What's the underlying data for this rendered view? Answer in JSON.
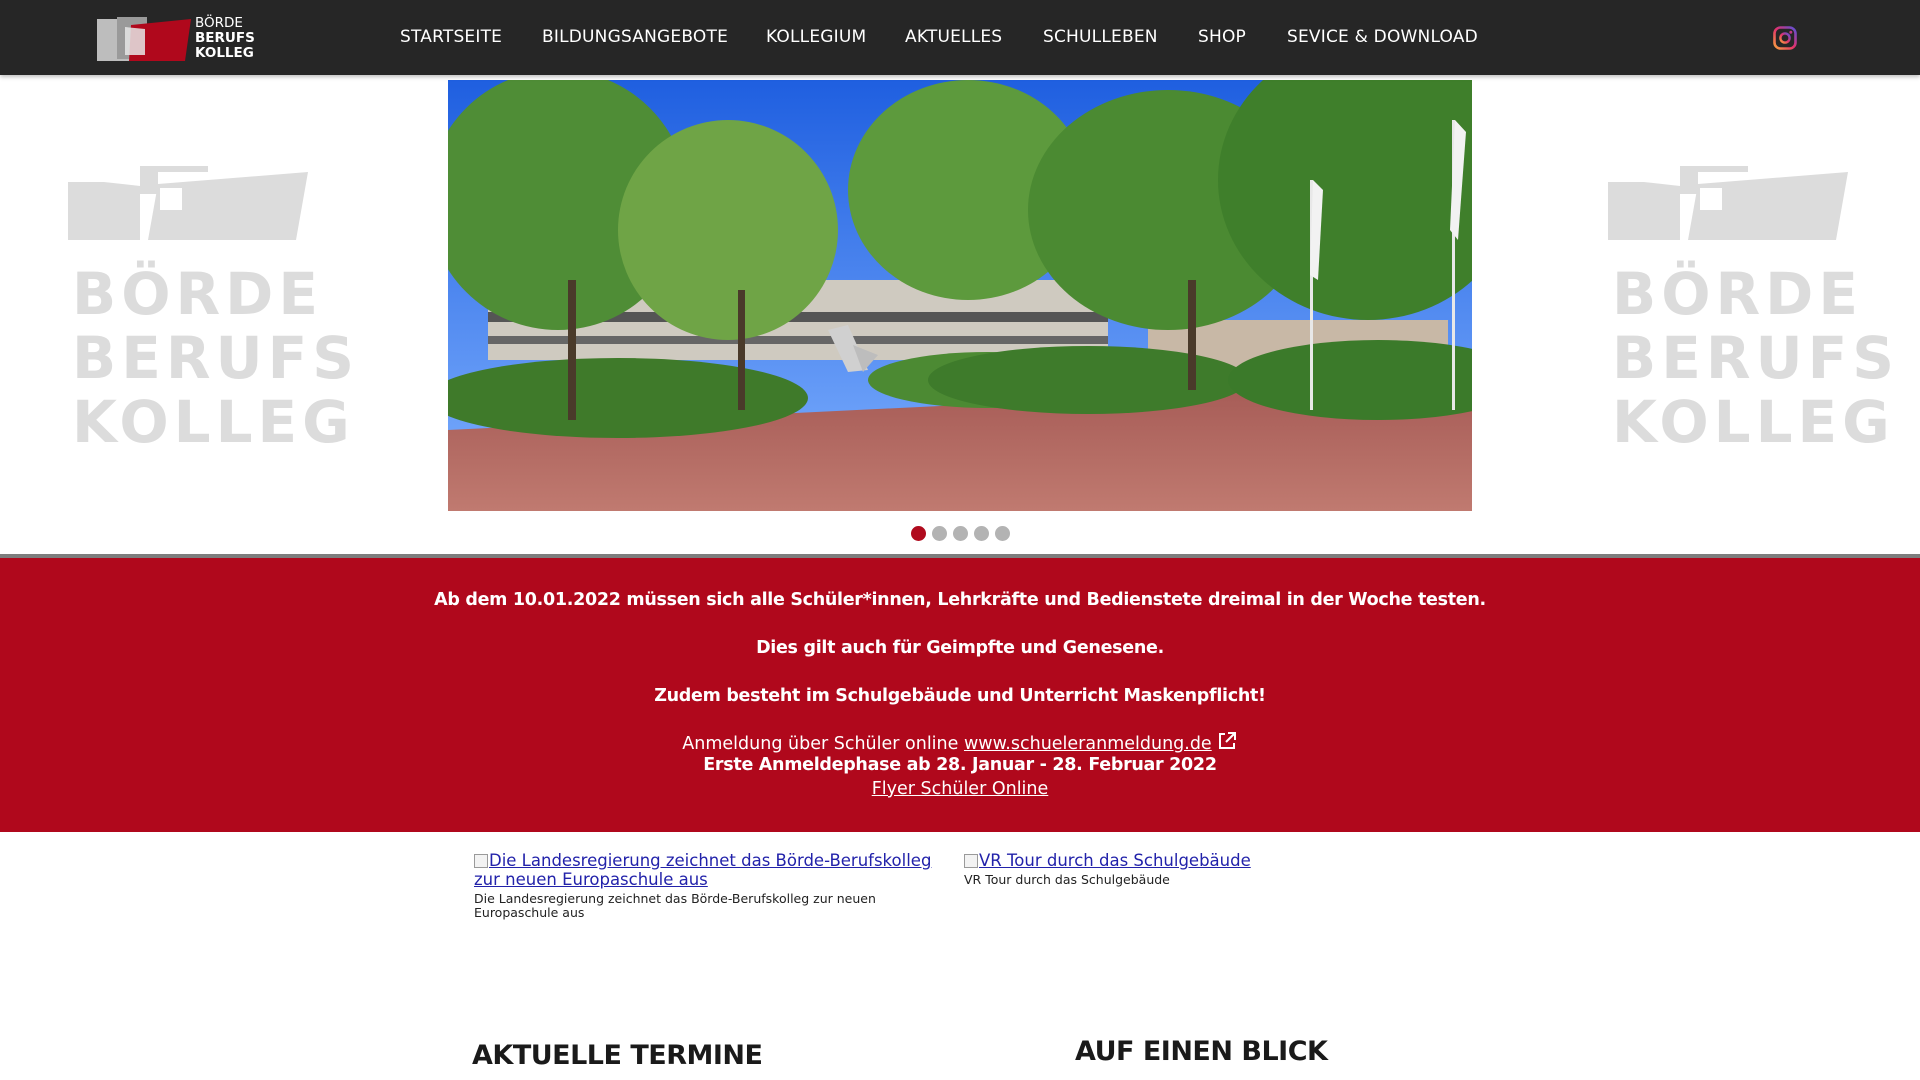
{
  "brand": {
    "logo_line1": "BÖRDE",
    "logo_line2": "BERUFS",
    "logo_line3": "KOLLEG",
    "colors": {
      "nav_bg": "#262626",
      "accent": "#b0081c",
      "side_logo": "#dcdcdc"
    }
  },
  "nav": {
    "items": [
      {
        "label": "STARTSEITE"
      },
      {
        "label": "BILDUNGSANGEBOTE"
      },
      {
        "label": "KOLLEGIUM"
      },
      {
        "label": "AKTUELLES"
      },
      {
        "label": "SCHULLEBEN"
      },
      {
        "label": "SHOP"
      },
      {
        "label": "SEVICE & DOWNLOAD"
      }
    ],
    "social_icon": "instagram-icon"
  },
  "side_logo": {
    "line1": "BÖRDE",
    "line2": "BERUFS",
    "line3": "KOLLEG"
  },
  "hero": {
    "slide_count": 5,
    "active_slide": 1
  },
  "announcement": {
    "line1": "Ab dem 10.01.2022 müssen sich alle Schüler*innen, Lehrkräfte und Bedienstete dreimal in der Woche testen.",
    "line2": "Dies gilt auch für Geimpfte und Genesene.",
    "line3": "Zudem besteht im Schulgebäude und Unterricht Maskenpflicht!",
    "registration_prefix": "Anmeldung über Schüler online ",
    "registration_link": "www.schueleranmeldung.de",
    "registration_icon": "external-link-icon",
    "phase": "Erste Anmeldephase ab 28. Januar - 28. Februar 2022",
    "flyer_link": "Flyer Schüler Online"
  },
  "teasers": [
    {
      "link": "Die Landesregierung zeichnet das Börde-Berufskolleg zur neuen Europaschule aus",
      "caption": "Die Landesregierung zeichnet das Börde-Berufskolleg zur neuen Europaschule aus"
    },
    {
      "link": "VR Tour durch das Schulgebäude",
      "caption": "VR Tour durch das Schulgebäude"
    }
  ],
  "sections": {
    "termine_title": "AKTUELLE TERMINE",
    "blick_title": "AUF EINEN BLICK"
  }
}
